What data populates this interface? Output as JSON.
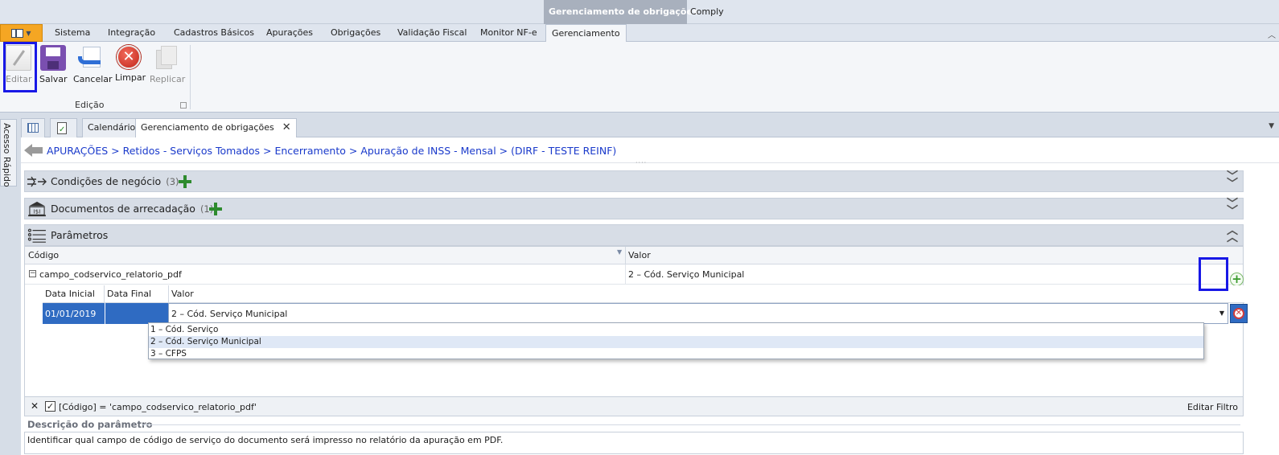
{
  "titlebar": {
    "context_title": "Gerenciamento de obrigações",
    "app_name": "Comply"
  },
  "menu": {
    "tabs": [
      "Sistema",
      "Integração",
      "Cadastros Básicos",
      "Apurações",
      "Obrigações",
      "Validação Fiscal",
      "Monitor NF-e",
      "Gerenciamento"
    ],
    "active_tab": "Gerenciamento"
  },
  "ribbon": {
    "buttons": [
      {
        "label": "Editar",
        "icon": "pencil-icon",
        "enabled": false
      },
      {
        "label": "Salvar",
        "icon": "floppy-disk-icon",
        "enabled": true
      },
      {
        "label": "Cancelar",
        "icon": "undo-document-icon",
        "enabled": true
      },
      {
        "label": "Limpar",
        "icon": "red-x-circle-icon",
        "enabled": true
      },
      {
        "label": "Replicar",
        "icon": "copy-pages-icon",
        "enabled": false
      }
    ],
    "group_label": "Edição"
  },
  "quick_access": "Acesso Rápido",
  "doc_tabs": [
    "Calendário",
    "Gerenciamento de obrigações"
  ],
  "breadcrumb": "APURAÇÕES > Retidos - Serviços Tomados > Encerramento > Apuração de INSS - Mensal > (DIRF - TESTE REINF)",
  "sections": [
    {
      "title": "Condições de negócio",
      "count": "(3)",
      "icon": "business-conditions-icon",
      "expanded": false
    },
    {
      "title": "Documentos de arrecadação",
      "count": "(1)",
      "icon": "bank-building-icon",
      "expanded": false
    },
    {
      "title": "Parâmetros",
      "count": "",
      "icon": "list-icon",
      "expanded": true
    }
  ],
  "params_grid": {
    "columns": [
      "Código",
      "Valor"
    ],
    "row": {
      "codigo": "campo_codservico_relatorio_pdf",
      "valor": "2 – Cód. Serviço Municipal"
    },
    "detail_columns": [
      "Data Inicial",
      "Data Final",
      "Valor"
    ],
    "detail_row": {
      "data_inicial": "01/01/2019",
      "data_final": "",
      "valor": "2 – Cód. Serviço Municipal"
    },
    "dropdown_options": [
      "1 – Cód. Serviço",
      "2 – Cód. Serviço Municipal",
      "3 – CFPS"
    ],
    "dropdown_selected": "2 – Cód. Serviço Municipal"
  },
  "filter": {
    "expression": "[Código] = 'campo_codservico_relatorio_pdf'",
    "edit_label": "Editar Filtro"
  },
  "description": {
    "title": "Descrição do parâmetro",
    "text": "Identificar qual campo de código de serviço do documento será impresso no relatório da apuração em PDF."
  }
}
